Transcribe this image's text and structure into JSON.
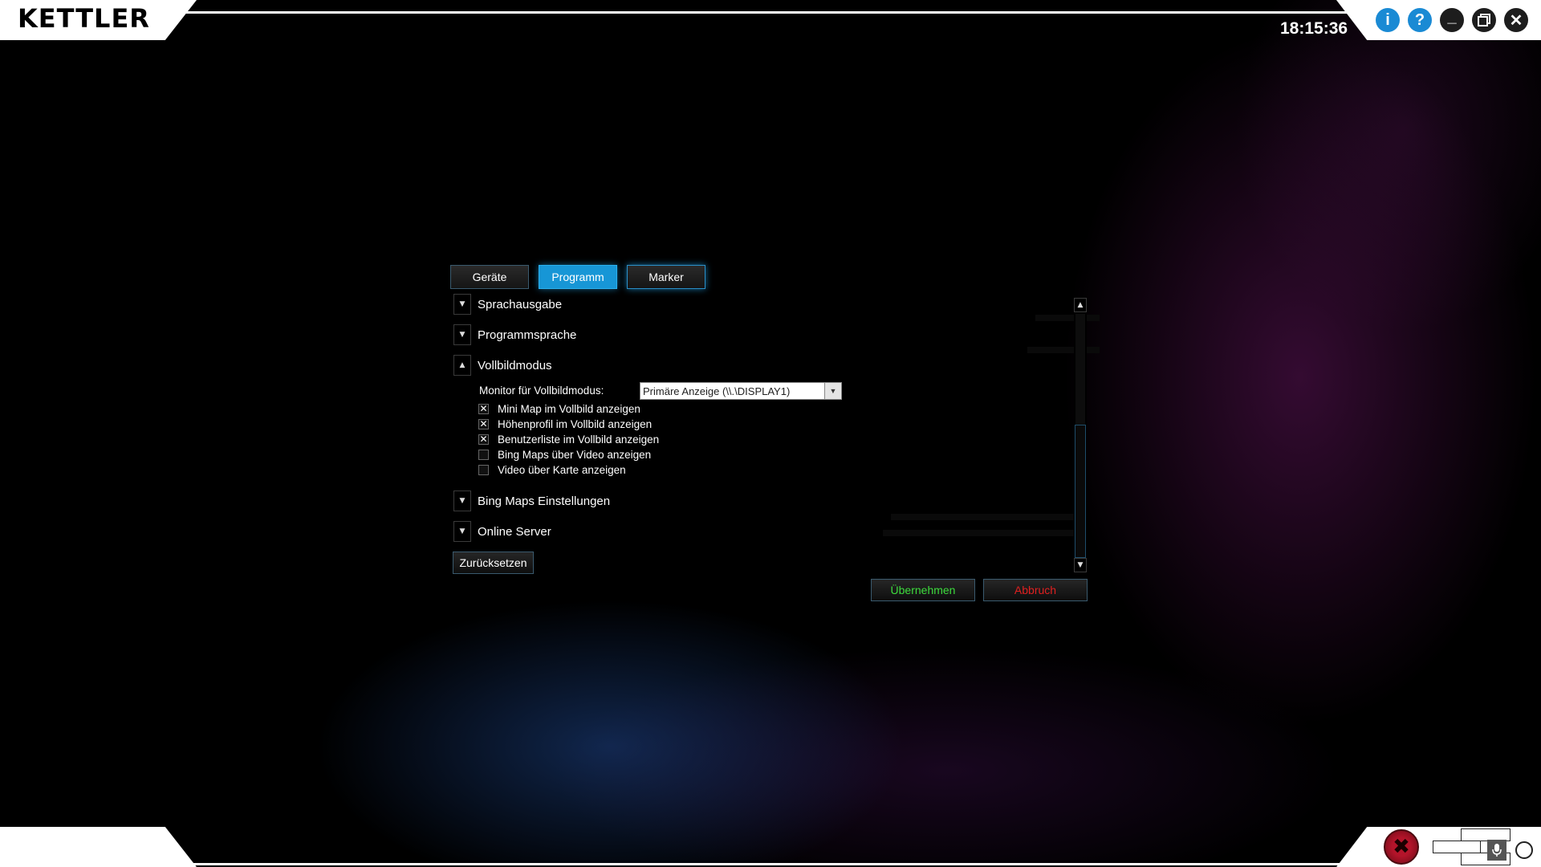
{
  "app": {
    "logo_text": "KETTLER",
    "clock": "18:15:36"
  },
  "window_controls": {
    "info_label": "i",
    "help_label": "?",
    "minimize_label": "_",
    "close_label": "✕"
  },
  "tabs": [
    {
      "label": "Geräte",
      "active": false
    },
    {
      "label": "Programm",
      "active": true
    },
    {
      "label": "Marker",
      "active": false
    }
  ],
  "sections": [
    {
      "label": "Sprachausgabe",
      "expanded": false
    },
    {
      "label": "Programmsprache",
      "expanded": false
    },
    {
      "label": "Vollbildmodus",
      "expanded": true
    },
    {
      "label": "Bing Maps Einstellungen",
      "expanded": false
    },
    {
      "label": "Online Server",
      "expanded": false
    }
  ],
  "vollbild": {
    "monitor_label": "Monitor für Vollbildmodus:",
    "monitor_value": "Primäre Anzeige (\\\\.\\DISPLAY1)",
    "options": [
      {
        "label": "Mini Map im Vollbild anzeigen",
        "checked": true
      },
      {
        "label": "Höhenprofil im Vollbild anzeigen",
        "checked": true
      },
      {
        "label": "Benutzerliste im Vollbild anzeigen",
        "checked": true
      },
      {
        "label": "Bing Maps über Video anzeigen",
        "checked": false
      },
      {
        "label": "Video über Karte anzeigen",
        "checked": false
      }
    ]
  },
  "buttons": {
    "reset": "Zurücksetzen",
    "apply": "Übernehmen",
    "cancel": "Abbruch"
  },
  "colors": {
    "accent": "#1796d6",
    "apply_text": "#3ddc3d",
    "cancel_text": "#e02020"
  }
}
